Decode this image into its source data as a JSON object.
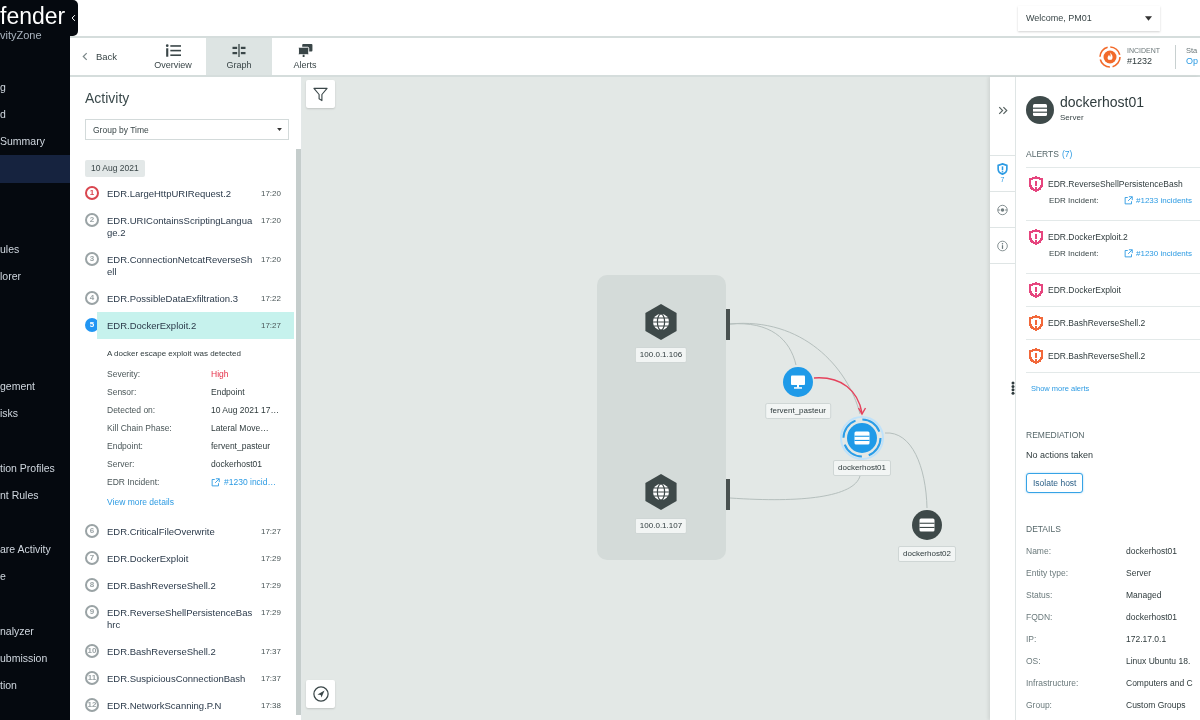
{
  "sidebar": {
    "logo": "fender",
    "logo_subtitle": "vityZone",
    "sections": [
      {
        "items": [
          {
            "label": "g",
            "selected": false
          },
          {
            "label": "d",
            "selected": false
          },
          {
            "label": "Summary",
            "selected": false
          },
          {
            "selected": true
          }
        ]
      },
      {
        "items": [
          {
            "label": "ules",
            "selected": false
          },
          {
            "label": "lorer",
            "selected": false
          }
        ]
      },
      {
        "items": [
          {
            "label": "gement",
            "selected": false
          },
          {
            "label": "isks",
            "selected": false
          }
        ]
      },
      {
        "items": [
          {
            "label": "tion Profiles",
            "selected": false
          },
          {
            "label": "nt Rules",
            "selected": false
          }
        ]
      },
      {
        "items": [
          {
            "label": "are Activity",
            "selected": false
          },
          {
            "label": "e",
            "selected": false
          }
        ]
      },
      {
        "items": [
          {
            "label": "nalyzer",
            "selected": false
          },
          {
            "label": "ubmission",
            "selected": false
          },
          {
            "label": "tion",
            "selected": false
          }
        ]
      }
    ]
  },
  "header": {
    "user_menu": "Welcome, PM01"
  },
  "toolbar": {
    "back": "Back",
    "tabs": [
      {
        "label": "Overview",
        "kind": "overview",
        "selected": false
      },
      {
        "label": "Graph",
        "kind": "graph",
        "selected": true
      },
      {
        "label": "Alerts",
        "kind": "alerts",
        "selected": false
      }
    ],
    "incident": {
      "label": "INCIDENT",
      "number": "#1232"
    },
    "status": {
      "label": "Sta",
      "value": "Op"
    }
  },
  "activity": {
    "title": "Activity",
    "group_by": "Group by Time",
    "date": "10 Aug 2021",
    "items": [
      {
        "number": "1",
        "name": "EDR.LargeHttpURIRequest.2",
        "time": "17:20",
        "color": "#d9464f",
        "selected": false
      },
      {
        "number": "2",
        "name": "EDR.URIContainsScriptingLanguage.2",
        "time": "17:20",
        "color": "#9aa3a5",
        "selected": false
      },
      {
        "number": "3",
        "name": "EDR.ConnectionNetcatReverseShell",
        "time": "17:20",
        "color": "#9aa3a5",
        "selected": false
      },
      {
        "number": "4",
        "name": "EDR.PossibleDataExfiltration.3",
        "time": "17:22",
        "color": "#9aa3a5",
        "selected": false
      },
      {
        "number": "5",
        "name": "EDR.DockerExploit.2",
        "time": "17:27",
        "color": "#2196f3",
        "selected": true,
        "details": {
          "description": "A docker escape exploit was detected",
          "fields": [
            {
              "label": "Severity:",
              "value": "High",
              "kind": "severity"
            },
            {
              "label": "Sensor:",
              "value": "Endpoint",
              "kind": "text"
            },
            {
              "label": "Detected on:",
              "value": "10 Aug 2021 17…",
              "kind": "text"
            },
            {
              "label": "Kill Chain Phase:",
              "value": "Lateral Move…",
              "kind": "text"
            },
            {
              "label": "Endpoint:",
              "value": "fervent_pasteur",
              "kind": "text"
            },
            {
              "label": "Server:",
              "value": "dockerhost01",
              "kind": "text"
            },
            {
              "label": "EDR Incident:",
              "value": "#1230 incid…",
              "kind": "link"
            }
          ],
          "more_link": "View more details"
        }
      },
      {
        "number": "6",
        "name": "EDR.CriticalFileOverwrite",
        "time": "17:27",
        "color": "#9aa3a5",
        "selected": false
      },
      {
        "number": "7",
        "name": "EDR.DockerExploit",
        "time": "17:29",
        "color": "#9aa3a5",
        "selected": false
      },
      {
        "number": "8",
        "name": "EDR.BashReverseShell.2",
        "time": "17:29",
        "color": "#9aa3a5",
        "selected": false
      },
      {
        "number": "9",
        "name": "EDR.ReverseShellPersistenceBashrc",
        "time": "17:29",
        "color": "#9aa3a5",
        "selected": false
      },
      {
        "number": "10",
        "name": "EDR.BashReverseShell.2",
        "time": "17:37",
        "color": "#9aa3a5",
        "selected": false
      },
      {
        "number": "11",
        "name": "EDR.SuspiciousConnectionBash",
        "time": "17:37",
        "color": "#9aa3a5",
        "selected": false
      },
      {
        "number": "12",
        "name": "EDR.NetworkScanning.P.N",
        "time": "17:38",
        "color": "#9aa3a5",
        "selected": false
      }
    ]
  },
  "graph": {
    "nodes": [
      {
        "label": "100.0.1.106",
        "kind": "ip",
        "highlighted": false,
        "selected": false
      },
      {
        "label": "100.0.1.107",
        "kind": "ip",
        "highlighted": false,
        "selected": false
      },
      {
        "label": "fervent_pasteur",
        "kind": "endpoint",
        "highlighted": true,
        "selected": false
      },
      {
        "label": "dockerhost01",
        "kind": "server",
        "highlighted": true,
        "selected": true
      },
      {
        "label": "dockerhost02",
        "kind": "server",
        "highlighted": false,
        "selected": false
      }
    ],
    "edges": [
      {
        "kind": "traffic"
      },
      {
        "kind": "traffic"
      },
      {
        "kind": "alert"
      },
      {
        "kind": "traffic"
      },
      {
        "kind": "traffic"
      }
    ]
  },
  "entity": {
    "name": "dockerhost01",
    "type": "Server",
    "side_tabs": [
      {
        "kind": "alerts",
        "badge": "7",
        "selected": true
      },
      {
        "kind": "network",
        "selected": false
      },
      {
        "kind": "info",
        "selected": false
      }
    ],
    "alerts_title": "ALERTS",
    "alerts_count": "(7)",
    "alerts": [
      {
        "name": "EDR.ReverseShellPersistenceBash",
        "color": "#e6457e",
        "incident_label": "EDR Incident:",
        "incident_link": "#1233 incidents"
      },
      {
        "name": "EDR.DockerExploit.2",
        "color": "#e6457e",
        "incident_label": "EDR Incident:",
        "incident_link": "#1230 incidents"
      },
      {
        "name": "EDR.DockerExploit",
        "color": "#e6457e"
      },
      {
        "name": "EDR.BashReverseShell.2",
        "color": "#f2683a"
      },
      {
        "name": "EDR.BashReverseShell.2",
        "color": "#f2683a"
      }
    ],
    "show_more": "Show more alerts",
    "remediation": {
      "title": "REMEDIATION",
      "status": "No actions taken",
      "button": "Isolate host"
    },
    "details": {
      "title": "DETAILS",
      "rows": [
        {
          "label": "Name:",
          "value": "dockerhost01"
        },
        {
          "label": "Entity type:",
          "value": "Server"
        },
        {
          "label": "Status:",
          "value": "Managed"
        },
        {
          "label": "FQDN:",
          "value": "dockerhost01"
        },
        {
          "label": "IP:",
          "value": "172.17.0.1"
        },
        {
          "label": "OS:",
          "value": "Linux Ubuntu 18."
        },
        {
          "label": "Infrastructure:",
          "value": "Computers and C"
        },
        {
          "label": "Group:",
          "value": "Custom Groups"
        }
      ]
    }
  }
}
